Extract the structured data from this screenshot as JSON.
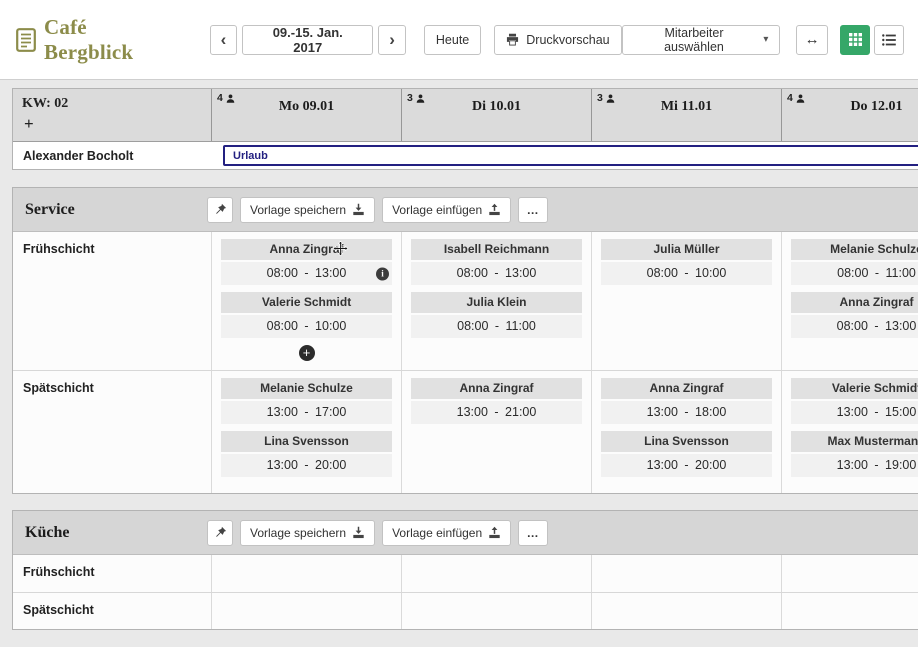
{
  "colors": {
    "accent_green": "#35a768",
    "absence_blue": "#232081",
    "logo_olive": "#8c8c4a"
  },
  "topbar": {
    "logo_title": "Café Bergblick",
    "prev_label": "‹",
    "date_range": "09.-15. Jan. 2017",
    "next_label": "›",
    "today_label": "Heute",
    "print_label": "Druckvorschau",
    "select_employees_label": "Mitarbeiter auswählen",
    "caret": "▾",
    "expand_label": "↔"
  },
  "week": {
    "kw_label": "KW: 02",
    "add_label": "+",
    "days": [
      {
        "count": "4",
        "label": "Mo 09.01"
      },
      {
        "count": "3",
        "label": "Di 10.01"
      },
      {
        "count": "3",
        "label": "Mi 11.01"
      },
      {
        "count": "4",
        "label": "Do 12.01"
      }
    ]
  },
  "absence": {
    "employee": "Alexander Bocholt",
    "label": "Urlaub"
  },
  "dept_toolbar": {
    "save_template": "Vorlage speichern",
    "insert_template": "Vorlage einfügen",
    "more": "…"
  },
  "misc": {
    "add_entry_label": "+",
    "info_glyph": "i"
  },
  "sections": [
    {
      "name": "Service",
      "rows": [
        {
          "label": "Frühschicht",
          "cells": [
            {
              "add": true,
              "entries": [
                {
                  "name": "Anna Zingraf",
                  "time": "08:00 - 13:00",
                  "info": true,
                  "cursor": true
                },
                {
                  "name": "Valerie Schmidt",
                  "time": "08:00 - 10:00"
                }
              ]
            },
            {
              "entries": [
                {
                  "name": "Isabell Reichmann",
                  "time": "08:00 - 13:00"
                },
                {
                  "name": "Julia Klein",
                  "time": "08:00 - 11:00"
                }
              ]
            },
            {
              "entries": [
                {
                  "name": "Julia Müller",
                  "time": "08:00 - 10:00"
                }
              ]
            },
            {
              "entries": [
                {
                  "name": "Melanie Schulze",
                  "time": "08:00 - 11:00"
                },
                {
                  "name": "Anna Zingraf",
                  "time": "08:00 - 13:00"
                }
              ]
            }
          ]
        },
        {
          "label": "Spätschicht",
          "cells": [
            {
              "entries": [
                {
                  "name": "Melanie Schulze",
                  "time": "13:00 - 17:00"
                },
                {
                  "name": "Lina Svensson",
                  "time": "13:00 - 20:00"
                }
              ]
            },
            {
              "entries": [
                {
                  "name": "Anna Zingraf",
                  "time": "13:00 - 21:00"
                }
              ]
            },
            {
              "entries": [
                {
                  "name": "Anna Zingraf",
                  "time": "13:00 - 18:00"
                },
                {
                  "name": "Lina Svensson",
                  "time": "13:00 - 20:00"
                }
              ]
            },
            {
              "entries": [
                {
                  "name": "Valerie Schmidt",
                  "time": "13:00 - 15:00"
                },
                {
                  "name": "Max Mustermann",
                  "time": "13:00 - 19:00"
                }
              ]
            }
          ]
        }
      ]
    },
    {
      "name": "Küche",
      "rows": [
        {
          "label": "Frühschicht",
          "cells": [
            {},
            {},
            {},
            {}
          ]
        },
        {
          "label": "Spätschicht",
          "cells": [
            {},
            {},
            {},
            {}
          ]
        }
      ]
    }
  ]
}
